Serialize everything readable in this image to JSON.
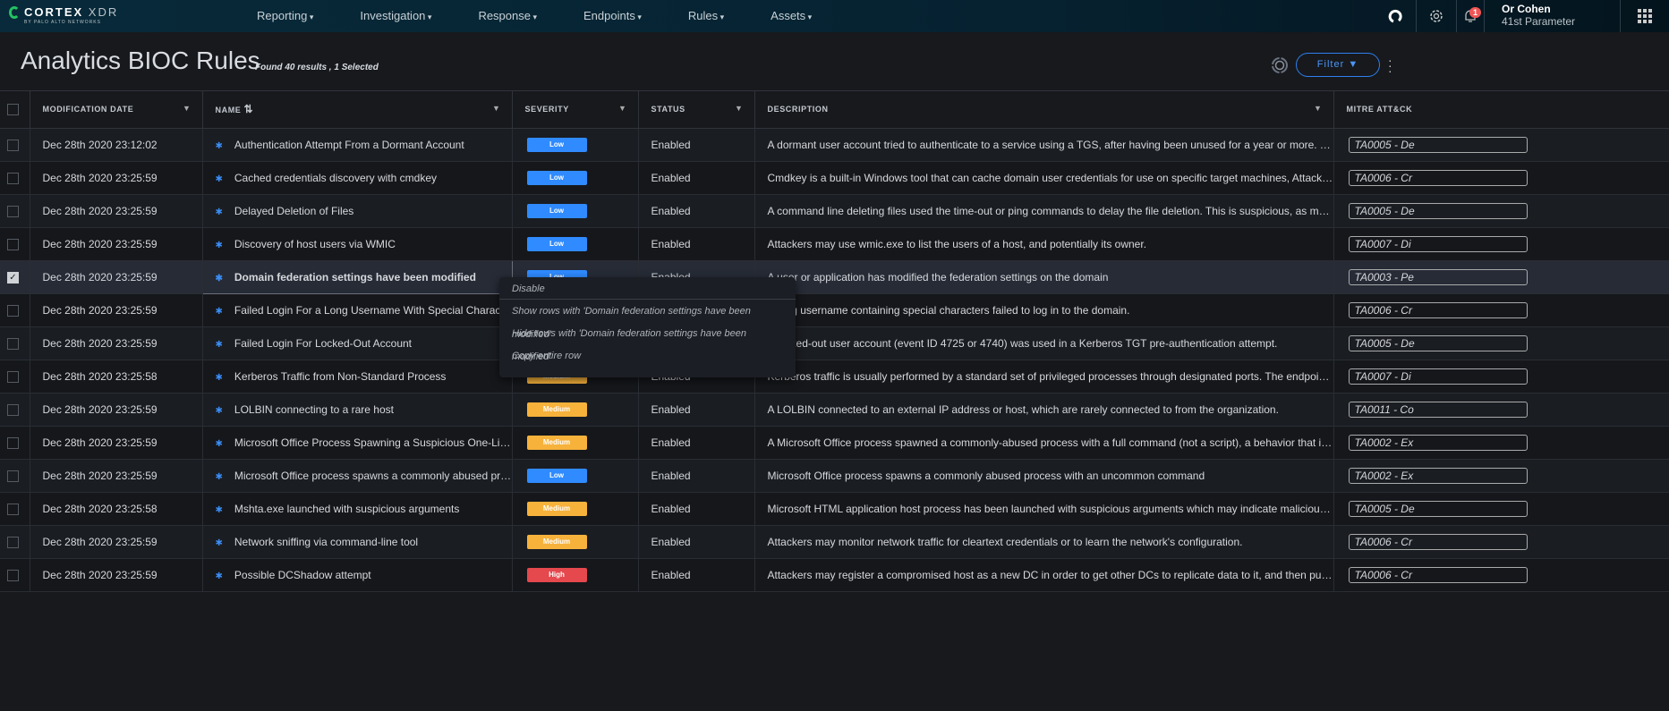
{
  "app": {
    "logo_main": "CORTEX",
    "logo_accent": "XDR",
    "logo_sub": "BY PALO ALTO NETWORKS"
  },
  "nav": [
    "Reporting",
    "Investigation",
    "Response",
    "Endpoints",
    "Rules",
    "Assets"
  ],
  "user": {
    "name": "Or Cohen",
    "org": "41st Parameter",
    "notifications": "1"
  },
  "page": {
    "title": "Analytics BIOC Rules",
    "found": "Found 40 results , 1 Selected",
    "filter_label": "Filter"
  },
  "columns": [
    "MODIFICATION DATE",
    "NAME",
    "SEVERITY",
    "STATUS",
    "DESCRIPTION",
    "MITRE ATT&CK"
  ],
  "colors": {
    "low": "#2f8bff",
    "medium": "#f7b23b",
    "high": "#e5484d",
    "accent": "#2f80ed"
  },
  "rows": [
    {
      "date": "Dec 28th 2020 23:12:02",
      "name": "Authentication Attempt From a Dormant Account",
      "severity": "Low",
      "status": "Enabled",
      "description": "A dormant user account tried to authenticate to a service using a TGS, after having been unused for a year or more. This may in...",
      "mitre": "TA0005 - De"
    },
    {
      "date": "Dec 28th 2020 23:25:59",
      "name": "Cached credentials discovery with cmdkey",
      "severity": "Low",
      "status": "Enabled",
      "description": "Cmdkey is a built-in Windows tool that can cache domain user credentials for use on specific target machines, Attackers can ac...",
      "mitre": "TA0006 - Cr"
    },
    {
      "date": "Dec 28th 2020 23:25:59",
      "name": "Delayed Deletion of Files",
      "severity": "Low",
      "status": "Enabled",
      "description": "A command line deleting files used the time-out or ping commands to delay the file deletion. This is suspicious, as malware som...",
      "mitre": "TA0005 - De"
    },
    {
      "date": "Dec 28th 2020 23:25:59",
      "name": "Discovery of host users via WMIC",
      "severity": "Low",
      "status": "Enabled",
      "description": "Attackers may use wmic.exe to list the users of a host, and potentially its owner.",
      "mitre": "TA0007 - Di"
    },
    {
      "date": "Dec 28th 2020 23:25:59",
      "name": "Domain federation settings have been modified",
      "severity": "Low",
      "status": "Enabled",
      "description": "A user or application has modified the federation settings on the domain",
      "mitre": "TA0003 - Pe",
      "selected": true
    },
    {
      "date": "Dec 28th 2020 23:25:59",
      "name": "Failed Login For a Long Username With Special Characters",
      "severity": "Low",
      "status": "Enabled",
      "description": "A long username containing special characters failed to log in to the domain.",
      "mitre": "TA0006 - Cr"
    },
    {
      "date": "Dec 28th 2020 23:25:59",
      "name": "Failed Login For Locked-Out Account",
      "severity": "Low",
      "status": "Enabled",
      "description": "A locked-out user account (event ID 4725 or 4740) was used in a Kerberos TGT pre-authentication attempt.",
      "mitre": "TA0005 - De"
    },
    {
      "date": "Dec 28th 2020 23:25:58",
      "name": "Kerberos Traffic from Non-Standard Process",
      "severity": "Medium",
      "status": "Enabled",
      "description": "Kerberos traffic is usually performed by a standard set of privileged processes through designated ports. The endpoint had a n...",
      "mitre": "TA0007 - Di"
    },
    {
      "date": "Dec 28th 2020 23:25:59",
      "name": "LOLBIN connecting to a rare host",
      "severity": "Medium",
      "status": "Enabled",
      "description": "A LOLBIN connected to an external IP address or host, which are rarely connected to from the organization.",
      "mitre": "TA0011 - Co"
    },
    {
      "date": "Dec 28th 2020 23:25:59",
      "name": "Microsoft Office Process Spawning a Suspicious One-Liner",
      "severity": "Medium",
      "status": "Enabled",
      "description": "A Microsoft Office process spawned a commonly-abused process with a full command (not a script), a behavior that is typically ...",
      "mitre": "TA0002 - Ex"
    },
    {
      "date": "Dec 28th 2020 23:25:59",
      "name": "Microsoft Office process spawns a commonly abused process",
      "severity": "Low",
      "status": "Enabled",
      "description": "Microsoft Office process spawns a commonly abused process with an uncommon command",
      "mitre": "TA0002 - Ex"
    },
    {
      "date": "Dec 28th 2020 23:25:58",
      "name": "Mshta.exe launched with suspicious arguments",
      "severity": "Medium",
      "status": "Enabled",
      "description": "Microsoft HTML application host process has been launched with suspicious arguments which may indicate malicious intent.",
      "mitre": "TA0005 - De"
    },
    {
      "date": "Dec 28th 2020 23:25:59",
      "name": "Network sniffing via command-line tool",
      "severity": "Medium",
      "status": "Enabled",
      "description": "Attackers may monitor network traffic for cleartext credentials or to learn the network's configuration.",
      "mitre": "TA0006 - Cr"
    },
    {
      "date": "Dec 28th 2020 23:25:59",
      "name": "Possible DCShadow attempt",
      "severity": "High",
      "status": "Enabled",
      "description": "Attackers may register a compromised host as a new DC in order to get other DCs to replicate data to it, and then push their o...",
      "mitre": "TA0006 - Cr"
    }
  ],
  "context_menu": [
    "Disable",
    "Show rows with 'Domain federation settings have been modified'",
    "Hide rows with 'Domain federation settings have been modified'",
    "Copy entire row"
  ]
}
